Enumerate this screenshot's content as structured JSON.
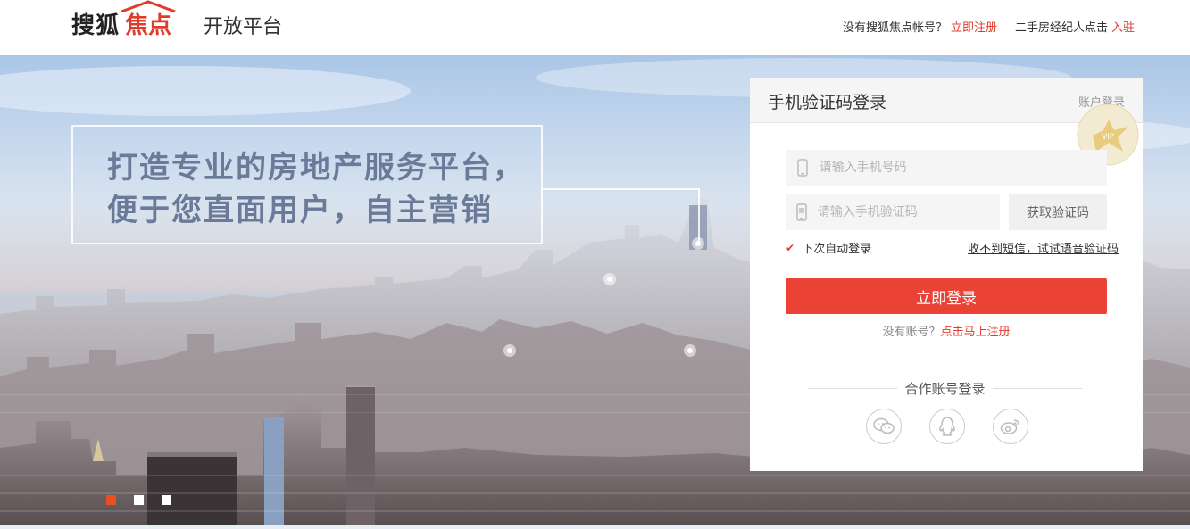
{
  "header": {
    "logo_sohu": "搜狐",
    "logo_focus": "焦点",
    "platform": "开放平台",
    "no_account": "没有搜狐焦点帐号？",
    "register_now": "立即注册",
    "agent_text": "二手房经纪人点击",
    "join": "入驻"
  },
  "banner": {
    "slogan_line1": "打造专业的房地产服务平台，",
    "slogan_line2": "便于您直面用户，自主营销",
    "slide_count": 3,
    "active_slide": 1
  },
  "login": {
    "title": "手机验证码登录",
    "switch": "账户登录",
    "vip_badge": "VIP",
    "phone_placeholder": "请输入手机号码",
    "code_placeholder": "请输入手机验证码",
    "get_code": "获取验证码",
    "remember": "下次自动登录",
    "voice_code": "收不到短信，试试语音验证码",
    "submit": "立即登录",
    "no_account": "没有账号？",
    "register": "点击马上注册",
    "partner_login": "合作账号登录",
    "social_icons": [
      "wechat-icon",
      "qq-icon",
      "weibo-icon"
    ]
  },
  "colors": {
    "accent": "#ea4335",
    "link_red": "#e03c2c",
    "slogan": "#6a7a98"
  }
}
